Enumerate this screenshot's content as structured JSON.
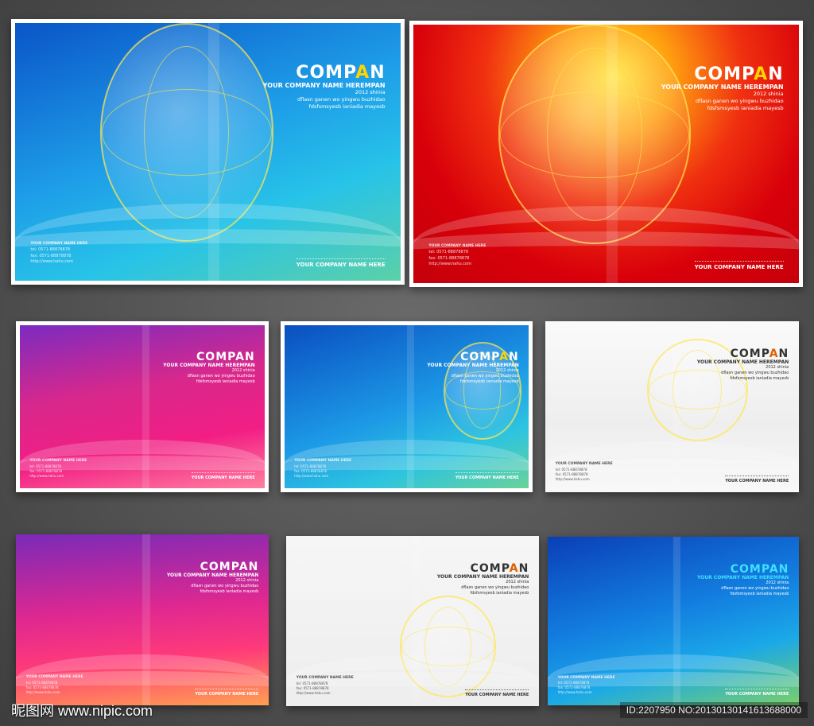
{
  "cover_text": {
    "title_prefix": "COMP",
    "title_accent": "A",
    "title_suffix": "N",
    "subtitle": "YOUR COMPANY NAME HEREMPAN",
    "year_line": "2012  shinia",
    "line1": "dflasn ganen wo yingwu buzhidao",
    "line2": "fdsfsmsyesb ianiadia mayesb",
    "footer": "YOUR COMPANY NAME HERE",
    "back_title": "YOUR COMPANY NAME HERE",
    "back_tel": "tel: 0571-88878878",
    "back_fax": "fax: 0571-88878878",
    "back_url": "http://www.hahu.com"
  },
  "cards": [
    {
      "id": "blue-large",
      "theme": "blue",
      "accent": "#ffd400"
    },
    {
      "id": "red-large",
      "theme": "red",
      "accent": "#ffd400"
    },
    {
      "id": "pink",
      "theme": "pink",
      "accent": "#ffffff"
    },
    {
      "id": "blue-small",
      "theme": "blue",
      "accent": "#ffd400"
    },
    {
      "id": "white-gray",
      "theme": "white",
      "accent": "#e06000"
    },
    {
      "id": "purple-pink",
      "theme": "pink",
      "accent": "#ffffff"
    },
    {
      "id": "white-globe",
      "theme": "white",
      "accent": "#e06000"
    },
    {
      "id": "blue-icons",
      "theme": "blue",
      "accent": "#3ee0ff"
    }
  ],
  "watermark": "昵图网 www.nipic.com",
  "image_id": "ID:2207950 NO:20130130141613688000"
}
